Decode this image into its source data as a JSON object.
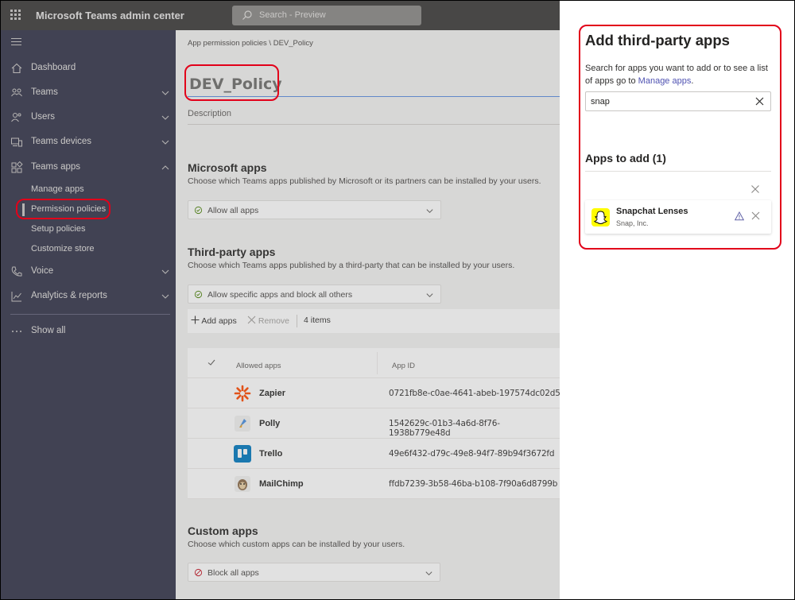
{
  "header": {
    "app_title": "Microsoft Teams admin center",
    "search_placeholder": "Search - Preview"
  },
  "sidebar": {
    "items": [
      {
        "label": "Dashboard",
        "icon": "home-icon"
      },
      {
        "label": "Teams",
        "icon": "teams-icon"
      },
      {
        "label": "Users",
        "icon": "users-icon"
      },
      {
        "label": "Teams devices",
        "icon": "devices-icon"
      },
      {
        "label": "Teams apps",
        "icon": "apps-icon"
      }
    ],
    "teams_apps_sub": [
      {
        "label": "Manage apps"
      },
      {
        "label": "Permission policies",
        "active": true
      },
      {
        "label": "Setup policies"
      },
      {
        "label": "Customize store"
      }
    ],
    "items_after": [
      {
        "label": "Voice",
        "icon": "phone-icon"
      },
      {
        "label": "Analytics & reports",
        "icon": "analytics-icon"
      }
    ],
    "show_all": "Show all"
  },
  "main": {
    "breadcrumb": "App permission policies \\ DEV_Policy",
    "policy_name": "DEV_Policy",
    "description_placeholder": "Description",
    "microsoft_apps": {
      "title": "Microsoft apps",
      "subtitle": "Choose which Teams apps published by Microsoft or its partners can be installed by your users.",
      "selected": "Allow all apps"
    },
    "third_party_apps": {
      "title": "Third-party apps",
      "subtitle": "Choose which Teams apps published by a third-party that can be installed by your users.",
      "selected": "Allow specific apps and block all others",
      "add_label": "Add apps",
      "remove_label": "Remove",
      "count_label": "4 items"
    },
    "table": {
      "col_name": "Allowed apps",
      "col_id": "App ID",
      "rows": [
        {
          "name": "Zapier",
          "id": "0721fb8e-c0ae-4641-abeb-197574dc02d5",
          "icon_color": "#ff4a00"
        },
        {
          "name": "Polly",
          "id": "1542629c-01b3-4a6d-8f76-1938b779e48d",
          "icon_color": "#f2f2f2"
        },
        {
          "name": "Trello",
          "id": "49e6f432-d79c-49e8-94f7-89b94f3672fd",
          "icon_color": "#0079bf"
        },
        {
          "name": "MailChimp",
          "id": "ffdb7239-3b58-46ba-b108-7f90a6d8799b",
          "icon_color": "#f2f2f2"
        }
      ]
    },
    "custom_apps": {
      "title": "Custom apps",
      "subtitle": "Choose which custom apps can be installed by your users.",
      "selected": "Block all apps"
    }
  },
  "panel": {
    "title": "Add third-party apps",
    "description": "Search for apps you want to add or to see a list of apps go to ",
    "link_text": "Manage apps",
    "description_end": ".",
    "search_value": "snap",
    "apps_to_add_label": "Apps to add (1)",
    "apps": [
      {
        "name": "Snapchat Lenses",
        "publisher": "Snap, Inc."
      }
    ]
  },
  "colors": {
    "sidebar_bg": "#33344a",
    "topbar_bg": "#3b3a39",
    "highlight_red": "#e2001a",
    "link_purple": "#4f52b2"
  }
}
